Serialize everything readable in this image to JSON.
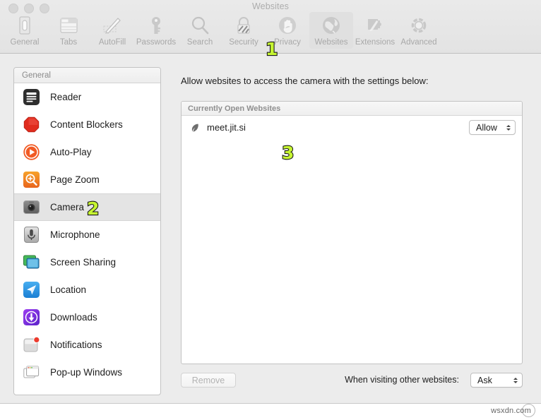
{
  "window": {
    "title": "Websites",
    "traffic_lights": [
      "close",
      "minimize",
      "zoom"
    ]
  },
  "toolbar": {
    "items": [
      {
        "label": "General",
        "icon": "general-icon",
        "selected": false
      },
      {
        "label": "Tabs",
        "icon": "tabs-icon",
        "selected": false
      },
      {
        "label": "AutoFill",
        "icon": "autofill-icon",
        "selected": false
      },
      {
        "label": "Passwords",
        "icon": "passwords-icon",
        "selected": false
      },
      {
        "label": "Search",
        "icon": "search-icon",
        "selected": false
      },
      {
        "label": "Security",
        "icon": "security-icon",
        "selected": false
      },
      {
        "label": "Privacy",
        "icon": "privacy-icon",
        "selected": false
      },
      {
        "label": "Websites",
        "icon": "websites-icon",
        "selected": true
      },
      {
        "label": "Extensions",
        "icon": "extensions-icon",
        "selected": false
      },
      {
        "label": "Advanced",
        "icon": "advanced-icon",
        "selected": false
      }
    ]
  },
  "sidebar": {
    "header": "General",
    "items": [
      {
        "label": "Reader",
        "icon": "reader-icon",
        "selected": false
      },
      {
        "label": "Content Blockers",
        "icon": "content-blockers-icon",
        "selected": false
      },
      {
        "label": "Auto-Play",
        "icon": "auto-play-icon",
        "selected": false
      },
      {
        "label": "Page Zoom",
        "icon": "page-zoom-icon",
        "selected": false
      },
      {
        "label": "Camera",
        "icon": "camera-icon",
        "selected": true
      },
      {
        "label": "Microphone",
        "icon": "microphone-icon",
        "selected": false
      },
      {
        "label": "Screen Sharing",
        "icon": "screen-sharing-icon",
        "selected": false
      },
      {
        "label": "Location",
        "icon": "location-icon",
        "selected": false
      },
      {
        "label": "Downloads",
        "icon": "downloads-icon",
        "selected": false
      },
      {
        "label": "Notifications",
        "icon": "notifications-icon",
        "selected": false
      },
      {
        "label": "Pop-up Windows",
        "icon": "popup-windows-icon",
        "selected": false
      }
    ]
  },
  "main": {
    "description": "Allow websites to access the camera with the settings below:",
    "list_header": "Currently Open Websites",
    "rows": [
      {
        "site": "meet.jit.si",
        "permission": "Allow",
        "favicon": "jitsi-leaf-icon"
      }
    ],
    "remove_button": "Remove",
    "default_label": "When visiting other websites:",
    "default_value": "Ask"
  },
  "annotations": [
    {
      "number": "1",
      "target": "websites-toolbar-item"
    },
    {
      "number": "2",
      "target": "sidebar-item-camera"
    },
    {
      "number": "3",
      "target": "website-list-area"
    }
  ],
  "watermark": {
    "text": "wsxdn.com"
  },
  "colors": {
    "window_bg": "#ececec",
    "titlebar_bg": "#e8e8e8",
    "panel_bg": "#ffffff",
    "selected_row": "#e4e4e4",
    "annotation_fill": "#c6f531",
    "annotation_stroke": "#1a1a1a",
    "text_primary": "#1d1d1d",
    "text_muted": "#8f8f8f",
    "toolbar_label": "#a8a8a8"
  }
}
